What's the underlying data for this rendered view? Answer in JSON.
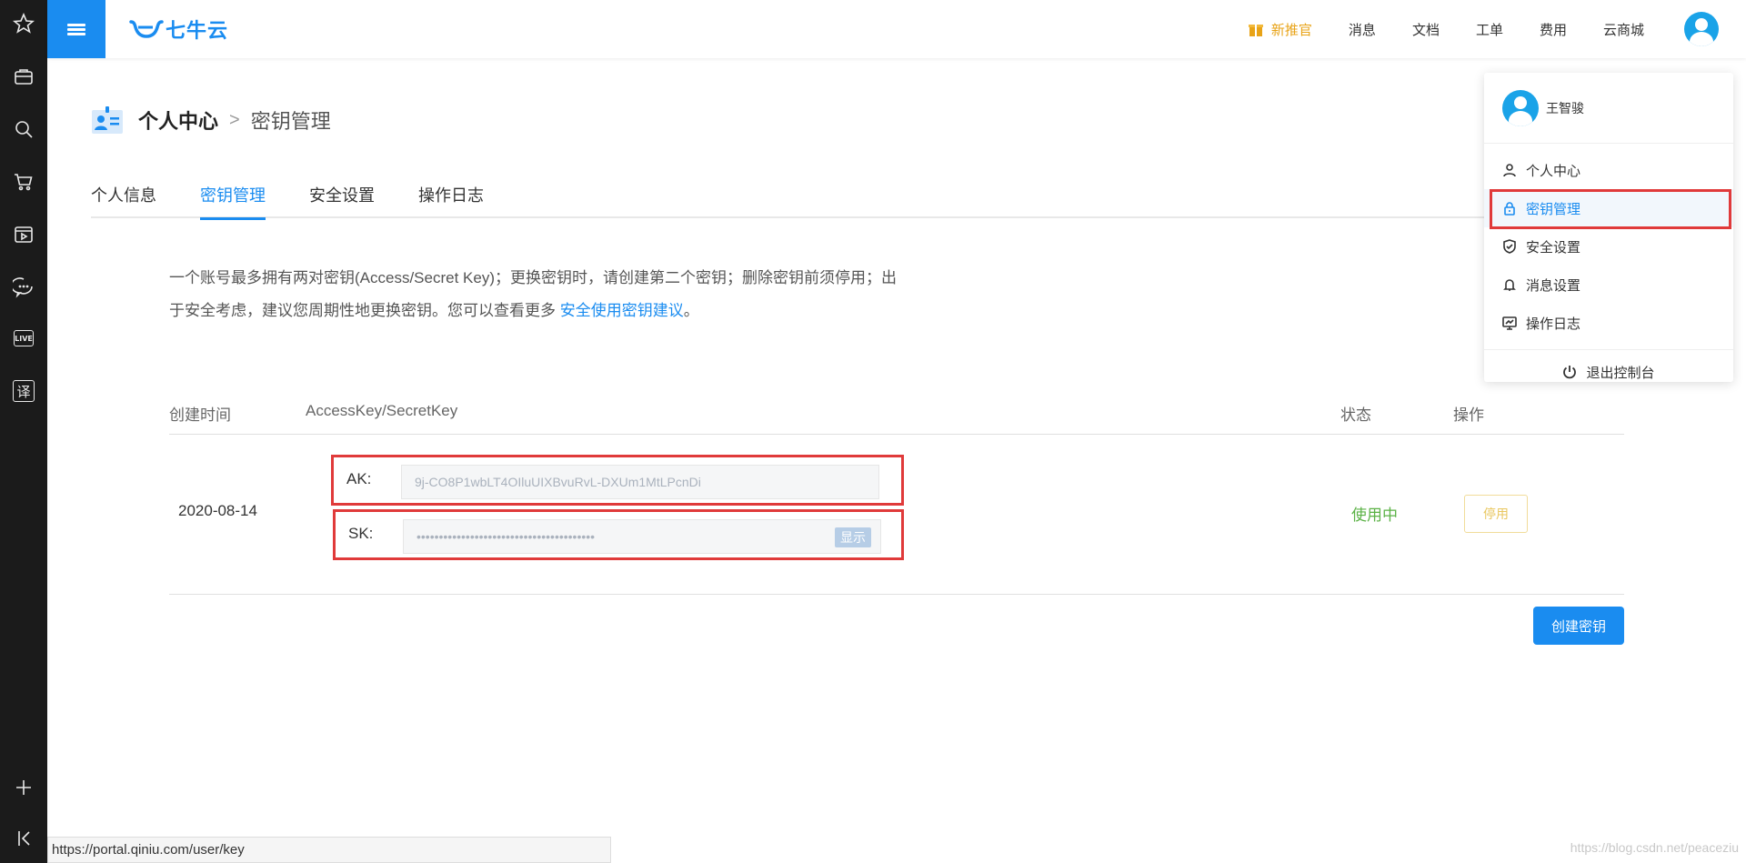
{
  "rail": {
    "icons": [
      "star-icon",
      "briefcase-icon",
      "search-icon",
      "cart-icon",
      "video-icon",
      "chat-icon",
      "live-icon",
      "translate-icon"
    ],
    "live_label": "LIVE",
    "translate_label": "译"
  },
  "topbar": {
    "logo_text": "七牛云",
    "promo": "新推官",
    "links": [
      "消息",
      "文档",
      "工单",
      "费用",
      "云商城"
    ],
    "accent": "#1a8cf0"
  },
  "breadcrumb": {
    "root": "个人中心",
    "separator": ">",
    "current": "密钥管理"
  },
  "tabs": [
    {
      "label": "个人信息"
    },
    {
      "label": "密钥管理",
      "active": true
    },
    {
      "label": "安全设置"
    },
    {
      "label": "操作日志"
    }
  ],
  "description": {
    "text": "一个账号最多拥有两对密钥(Access/Secret Key)；更换密钥时，请创建第二个密钥；删除密钥前须停用；出于安全考虑，建议您周期性地更换密钥。您可以查看更多 ",
    "link": "安全使用密钥建议",
    "suffix": "。"
  },
  "table": {
    "headers": {
      "created": "创建时间",
      "keys": "AccessKey/SecretKey",
      "status": "状态",
      "action": "操作"
    },
    "row": {
      "date": "2020-08-14",
      "ak_label": "AK:",
      "ak_value": "9j-CO8P1wbLT4OIluUIXBvuRvL-DXUm1MtLPcnDi",
      "sk_label": "SK:",
      "sk_value": "••••••••••••••••••••••••••••••••••••••••",
      "show_label": "显示",
      "status": "使用中",
      "action": "停用"
    },
    "create_button": "创建密钥"
  },
  "dropdown": {
    "username": "王智骏",
    "items": [
      {
        "label": "个人中心",
        "icon": "user-icon"
      },
      {
        "label": "密钥管理",
        "icon": "lock-icon",
        "active": true
      },
      {
        "label": "安全设置",
        "icon": "shield-icon"
      },
      {
        "label": "消息设置",
        "icon": "bell-icon"
      },
      {
        "label": "操作日志",
        "icon": "monitor-icon"
      }
    ],
    "logout": "退出控制台"
  },
  "status_bar": {
    "url": "https://portal.qiniu.com/user/key"
  },
  "watermark": "https://blog.csdn.net/peaceziu"
}
